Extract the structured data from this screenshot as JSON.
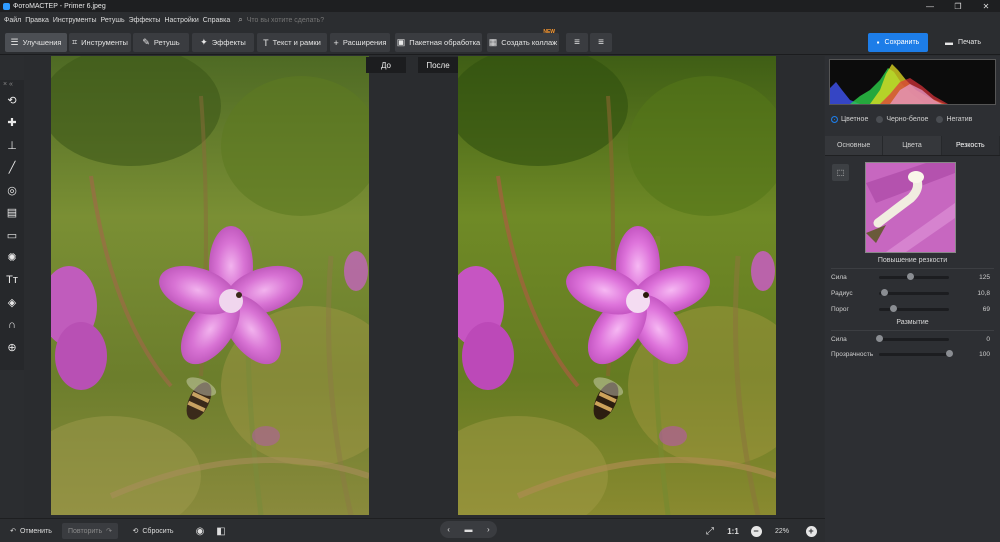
{
  "window": {
    "title": "ФотоМАСТЕР - Primer 6.jpeg",
    "controls": [
      "—",
      "❐",
      "✕"
    ]
  },
  "menu": {
    "items": [
      "Файл",
      "Правка",
      "Инструменты",
      "Ретушь",
      "Эффекты",
      "Настройки",
      "Справка"
    ],
    "search_placeholder": "Что вы хотите сделать?"
  },
  "toolbar": {
    "tabs": [
      {
        "label": "Улучшения",
        "icon": "sliders-icon"
      },
      {
        "label": "Инструменты",
        "icon": "crop-icon"
      },
      {
        "label": "Ретушь",
        "icon": "brush-icon"
      },
      {
        "label": "Эффекты",
        "icon": "sparkle-icon"
      },
      {
        "label": "Текст и рамки",
        "icon": "text-icon"
      },
      {
        "label": "Расширения",
        "icon": "plus-icon"
      }
    ],
    "batch_label": "Пакетная обработка",
    "collage_label": "Создать коллаж",
    "new_badge": "NEW",
    "save_label": "Сохранить",
    "print_label": "Печать"
  },
  "left_tools": [
    "rotate-icon",
    "patch-icon",
    "stamp-icon",
    "brush-tool-icon",
    "radial-icon",
    "gradient-icon",
    "vignette-icon",
    "light-icon",
    "text-tool-icon",
    "fill-icon",
    "lasso-icon",
    "globe-icon"
  ],
  "compare": {
    "before_label": "До",
    "after_label": "После"
  },
  "panel": {
    "modes": [
      {
        "label": "Цветное",
        "checked": true
      },
      {
        "label": "Черно-белое",
        "checked": false
      },
      {
        "label": "Негатив",
        "checked": false
      }
    ],
    "subtabs": [
      "Основные",
      "Цвета",
      "Резкость"
    ],
    "active_subtab": "Резкость",
    "sharpen_title": "Повышение резкости",
    "sharpen": [
      {
        "label": "Сила",
        "value": "125",
        "level": 0.45
      },
      {
        "label": "Радиус",
        "value": "10,8",
        "level": 0.08
      },
      {
        "label": "Порог",
        "value": "69",
        "level": 0.2
      }
    ],
    "blur_title": "Размытие",
    "blur": [
      {
        "label": "Сила",
        "value": "0",
        "level": 0.0
      },
      {
        "label": "Прозрачность",
        "value": "100",
        "level": 1.0
      }
    ]
  },
  "bottom": {
    "undo_label": "Отменить",
    "redo_label": "Повторить",
    "reset_label": "Сбросить",
    "zoom_ratio": "1:1",
    "zoom_value": "22%"
  }
}
